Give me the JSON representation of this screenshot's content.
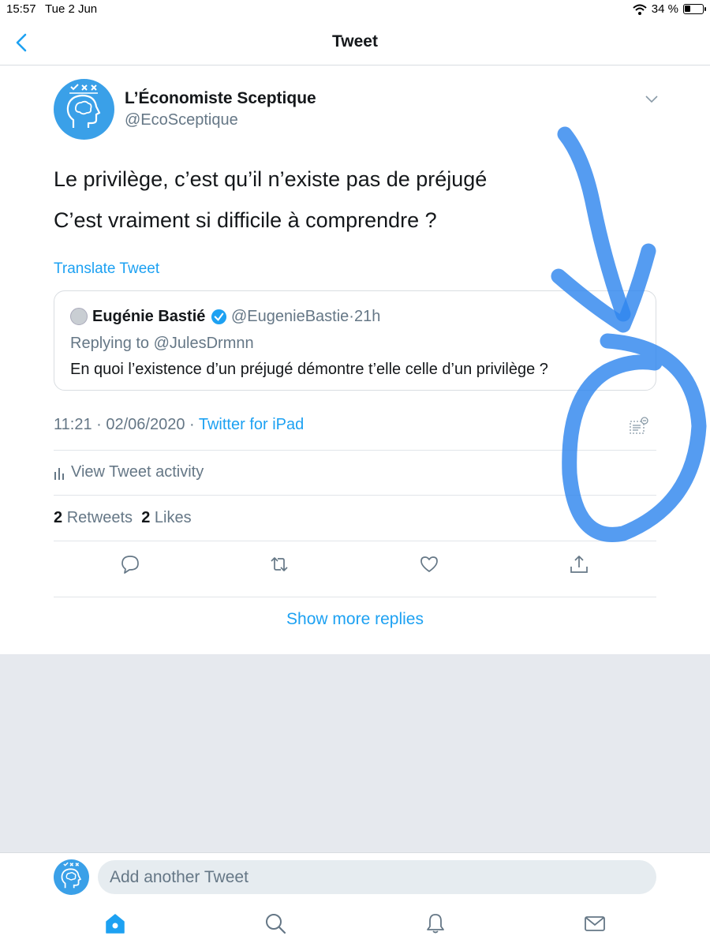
{
  "status_bar": {
    "time": "15:57",
    "date": "Tue 2 Jun",
    "battery": "34 %",
    "battery_level": 0.34
  },
  "header": {
    "title": "Tweet"
  },
  "tweet": {
    "author_name": "L’Économiste Sceptique",
    "author_handle": "@EcoSceptique",
    "text_lines": [
      "Le privilège, c’est qu’il n’existe pas de préjugé",
      "C’est vraiment si difficile à comprendre ?"
    ],
    "translate_label": "Translate Tweet",
    "timestamp": "11:21 · 02/06/2020 · ",
    "source": "Twitter for iPad",
    "activity_label": "View Tweet activity",
    "retweet_count": "2",
    "retweet_label": "Retweets",
    "like_count": "2",
    "like_label": "Likes"
  },
  "quoted_tweet": {
    "author_name": "Eugénie Bastié",
    "author_handle": "@EugenieBastie",
    "time_ago": "·21h",
    "replying_to": "Replying to @JulesDrmnn",
    "text": "En quoi l’existence d’un préjugé démontre t’elle celle d’un privilège ?"
  },
  "show_more_replies": "Show more replies",
  "composer": {
    "placeholder": "Add another Tweet"
  },
  "icons": {
    "back": "chevron-left-icon",
    "caret": "chevron-down-icon",
    "verified": "verified-badge-icon",
    "doc": "document-icon",
    "activity": "bar-chart-icon",
    "reply": "reply-icon",
    "retweet": "retweet-icon",
    "like": "heart-icon",
    "share": "share-icon",
    "home": "home-icon",
    "search": "search-icon",
    "notifications": "bell-icon",
    "messages": "mail-icon"
  },
  "colors": {
    "accent": "#1da1f2",
    "annotation": "#2f86ee",
    "muted": "#657786"
  }
}
